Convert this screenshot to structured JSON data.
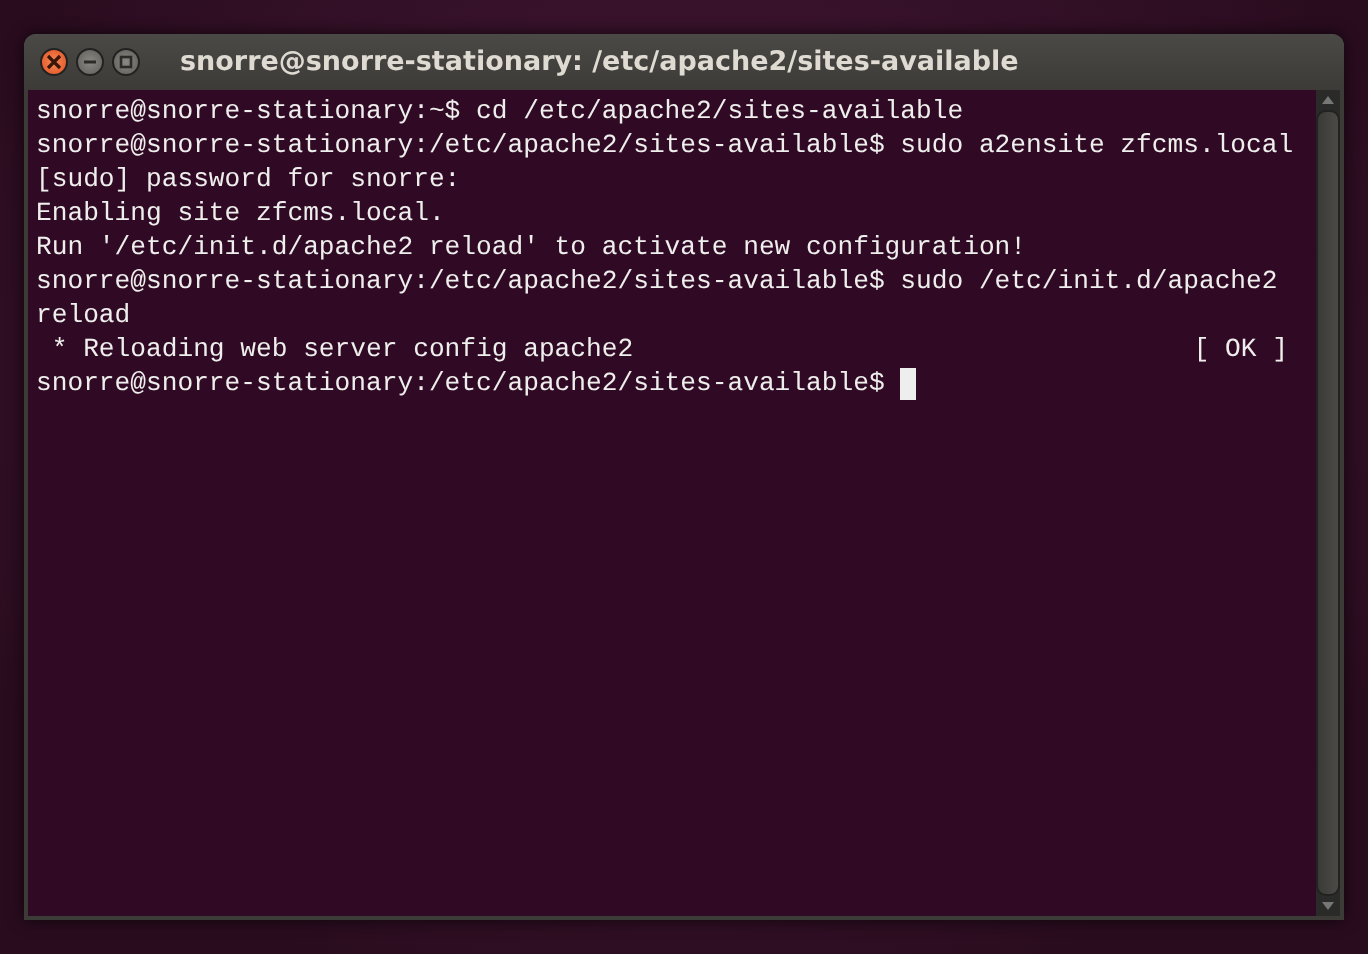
{
  "window": {
    "title": "snorre@snorre-stationary: /etc/apache2/sites-available"
  },
  "terminal": {
    "lines": [
      {
        "kind": "text",
        "text": "snorre@snorre-stationary:~$ cd /etc/apache2/sites-available"
      },
      {
        "kind": "text",
        "text": "snorre@snorre-stationary:/etc/apache2/sites-available$ sudo a2ensite zfcms.local"
      },
      {
        "kind": "text",
        "text": "[sudo] password for snorre:"
      },
      {
        "kind": "text",
        "text": "Enabling site zfcms.local."
      },
      {
        "kind": "text",
        "text": "Run '/etc/init.d/apache2 reload' to activate new configuration!"
      },
      {
        "kind": "text",
        "text": "snorre@snorre-stationary:/etc/apache2/sites-available$ sudo /etc/init.d/apache2"
      },
      {
        "kind": "text",
        "text": "reload"
      },
      {
        "kind": "status",
        "text": " * Reloading web server config apache2",
        "status": "[ OK ]"
      },
      {
        "kind": "prompt",
        "text": "snorre@snorre-stationary:/etc/apache2/sites-available$",
        "cursor": true
      }
    ]
  }
}
